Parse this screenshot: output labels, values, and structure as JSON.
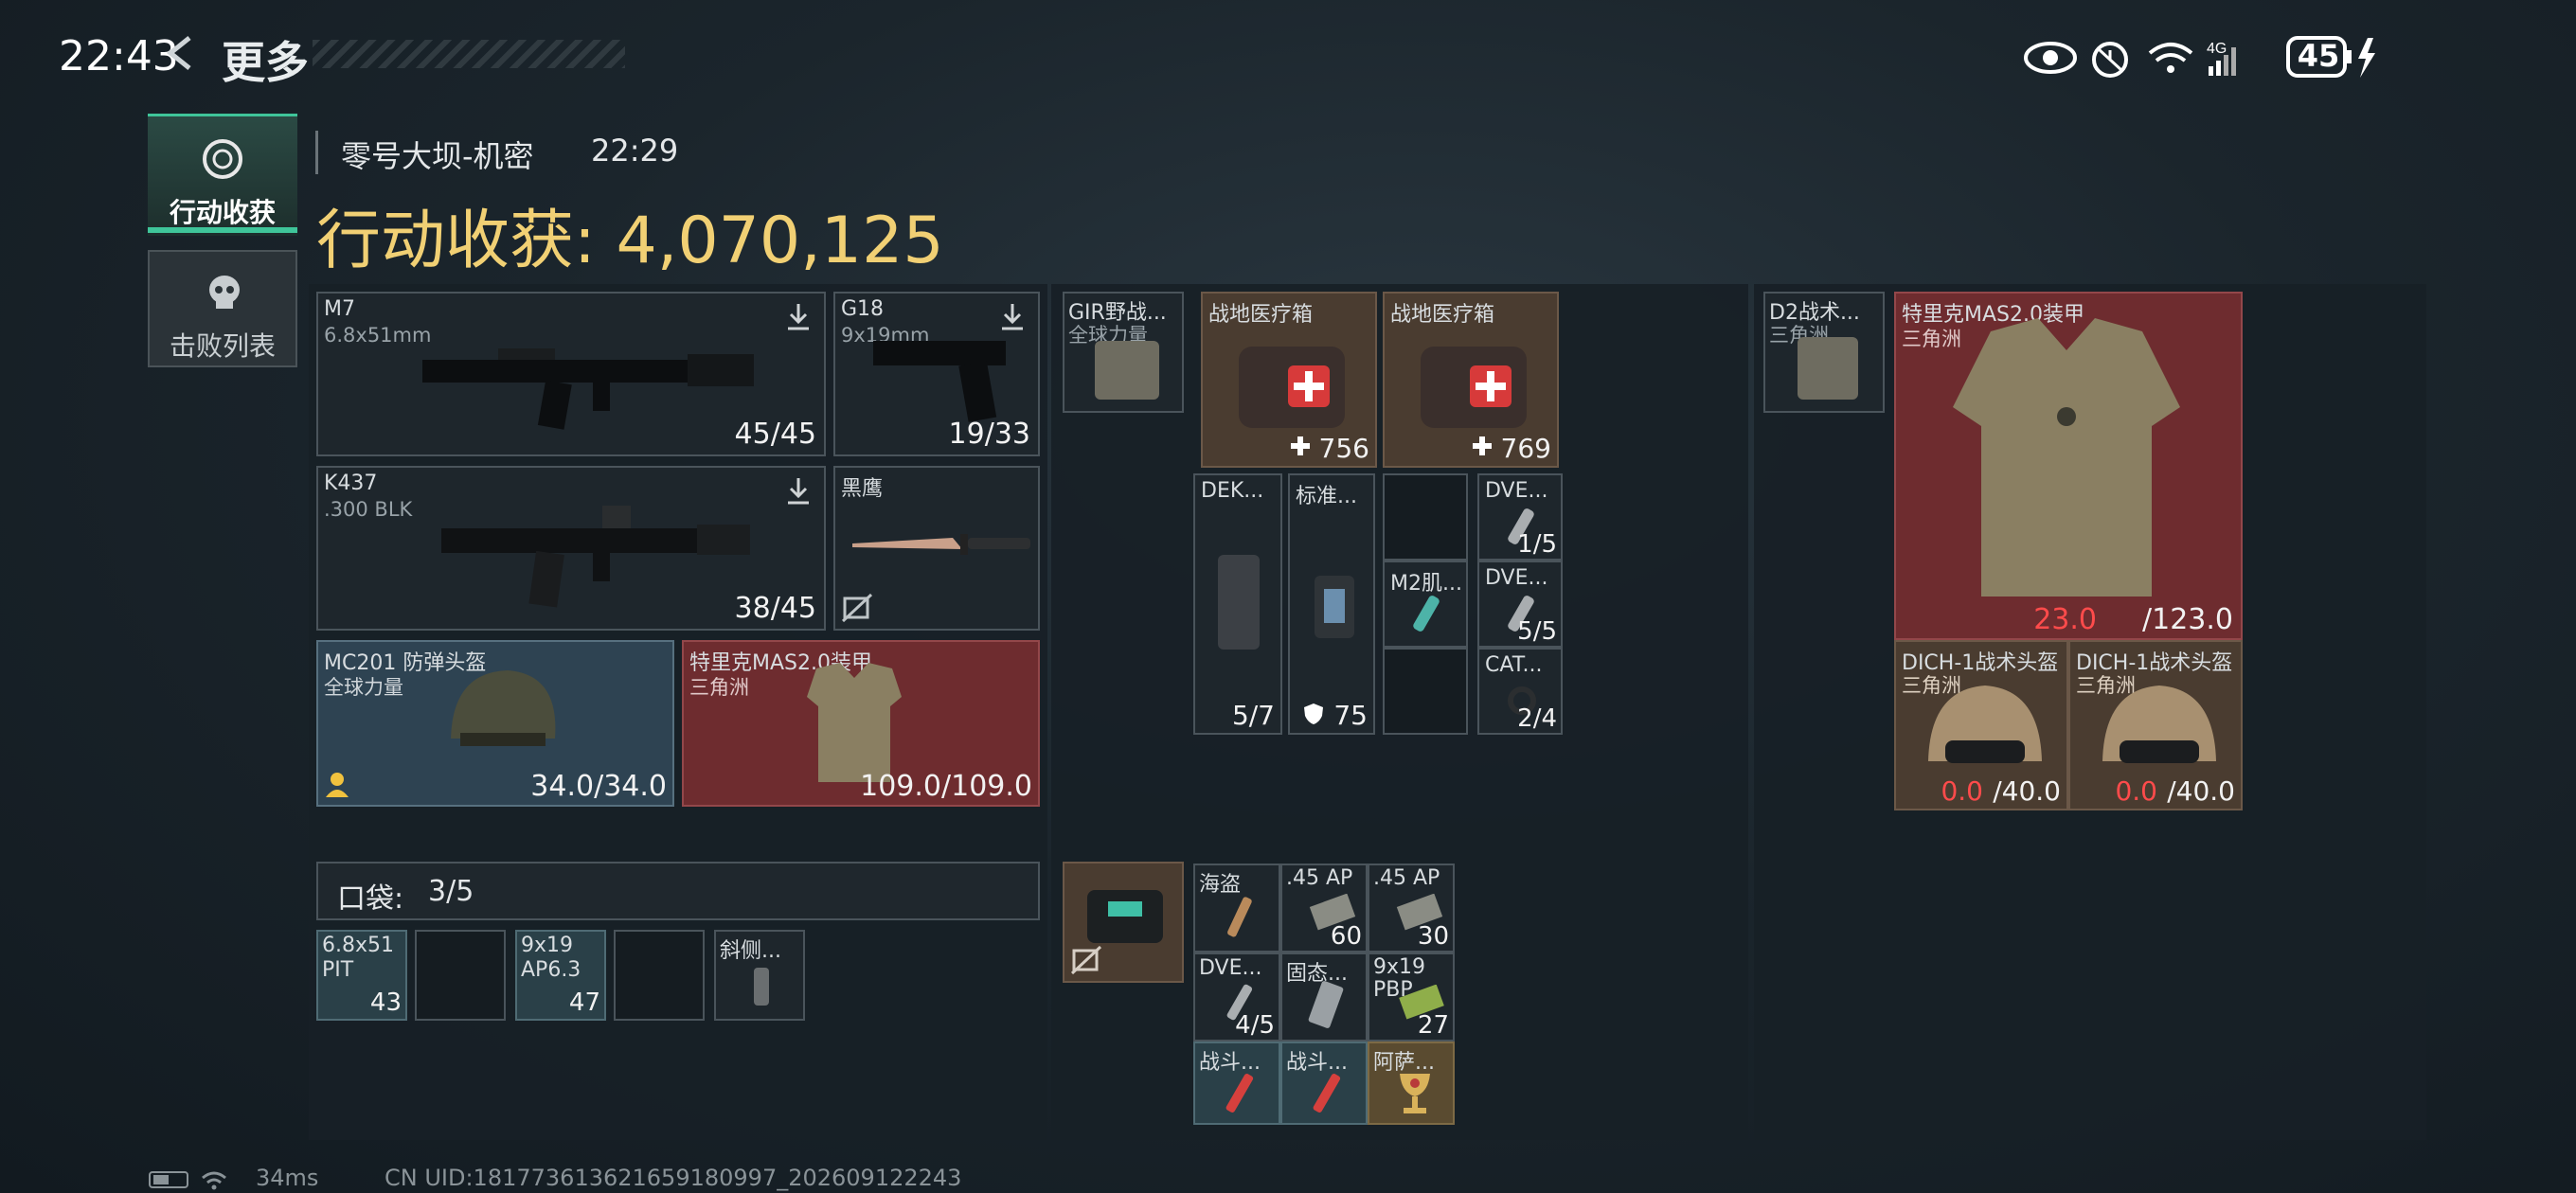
{
  "status_bar": {
    "time": "22:43",
    "battery": "45"
  },
  "header": {
    "back_title": "更多"
  },
  "sidebar": {
    "tabs": [
      {
        "label": "行动收获",
        "active": true
      },
      {
        "label": "击败列表",
        "active": false
      }
    ]
  },
  "match": {
    "map": "零号大坝-机密",
    "time": "22:29",
    "title": "行动收获: 4,070,125"
  },
  "weapons": [
    {
      "name": "M7",
      "caliber": "6.8x51mm",
      "ammo": "45/45"
    },
    {
      "name": "G18",
      "caliber": "9x19mm",
      "ammo": "19/33"
    },
    {
      "name": "K437",
      "caliber": ".300 BLK",
      "ammo": "38/45"
    },
    {
      "name": "黑鹰",
      "caliber": "",
      "ammo": ""
    }
  ],
  "gear": [
    {
      "name": "MC201 防弹头盔",
      "sub": "全球力量",
      "dur": "34.0/34.0"
    },
    {
      "name": "特里克MAS2.0装甲",
      "sub": "三角洲",
      "dur": "109.0/109.0"
    }
  ],
  "pocket": {
    "label": "口袋:",
    "count": "3/5",
    "items": [
      {
        "name": "6.8x51",
        "sub": "PIT",
        "qty": "43"
      },
      {
        "name": "",
        "qty": ""
      },
      {
        "name": "9x19",
        "sub": "AP6.3",
        "qty": "47"
      },
      {
        "name": "",
        "qty": ""
      },
      {
        "name": "斜侧...",
        "qty": ""
      }
    ]
  },
  "rig": {
    "name": "GIR野战...",
    "sub": "全球力量",
    "items": [
      {
        "name": "战地医疗箱",
        "qty": "756"
      },
      {
        "name": "战地医疗箱",
        "qty": "769"
      },
      {
        "name": "DEK...",
        "qty": "5/7"
      },
      {
        "name": "标准...",
        "qty": "75"
      },
      {
        "name": "M2肌...",
        "qty": ""
      },
      {
        "name": "DVE...",
        "qty": "1/5"
      },
      {
        "name": "DVE...",
        "qty": "5/5"
      },
      {
        "name": "CAT...",
        "qty": "2/4"
      }
    ]
  },
  "backpack": {
    "items": [
      {
        "name": "海盗",
        "qty": ""
      },
      {
        "name": ".45 AP",
        "qty": "60"
      },
      {
        "name": ".45 AP",
        "qty": "30"
      },
      {
        "name": "DVE...",
        "qty": "4/5"
      },
      {
        "name": "固态...",
        "qty": ""
      },
      {
        "name": "9x19 PBP",
        "qty": "27"
      },
      {
        "name": "战斗...",
        "qty": ""
      },
      {
        "name": "战斗...",
        "qty": ""
      },
      {
        "name": "阿萨...",
        "qty": ""
      }
    ]
  },
  "stash": {
    "rig_name": "D2战术...",
    "rig_sub": "三角洲",
    "armor": {
      "name": "特里克MAS2.0装甲",
      "sub": "三角洲",
      "cur": "23.0",
      "max": "/123.0"
    },
    "helmets": [
      {
        "name": "DICH-1战术头盔",
        "sub": "三角洲",
        "cur": "0.0",
        "max": "/40.0"
      },
      {
        "name": "DICH-1战术头盔",
        "sub": "三角洲",
        "cur": "0.0",
        "max": "/40.0"
      }
    ]
  },
  "footer": {
    "ping": "34ms",
    "uid": "CN UID:18177361362165918099​7_202609122243"
  },
  "colors": {
    "gold": "#f1d074",
    "accent_green": "#3fc59a",
    "red_text": "#ff4b4b",
    "red_cell": "#6e2c2f",
    "blue_cell": "#2e4352"
  }
}
